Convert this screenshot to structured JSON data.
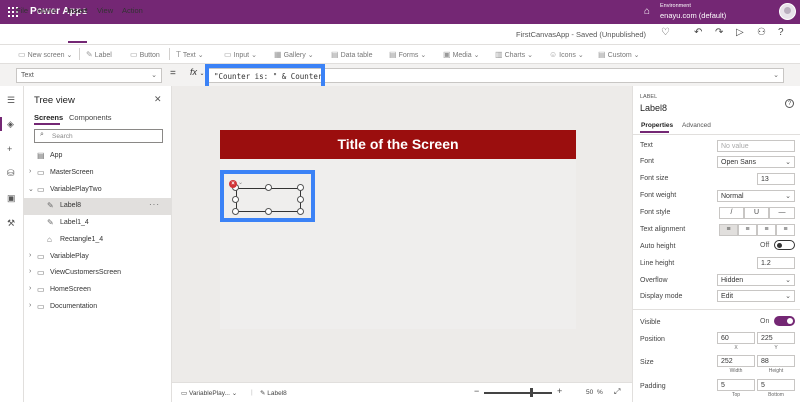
{
  "app": {
    "title": "Power Apps",
    "environment_label": "Environment",
    "environment_name": "enayu.com (default)"
  },
  "menu": {
    "items": [
      "File",
      "Home",
      "Insert",
      "View",
      "Action"
    ],
    "active": "Insert",
    "doc_status": "FirstCanvasApp - Saved (Unpublished)"
  },
  "ribbon": {
    "new_screen": "New screen",
    "label": "Label",
    "button": "Button",
    "text": "Text",
    "input": "Input",
    "gallery": "Gallery",
    "data_table": "Data table",
    "forms": "Forms",
    "media": "Media",
    "charts": "Charts",
    "icons": "Icons",
    "custom": "Custom"
  },
  "formula": {
    "property": "Text",
    "equals": "=",
    "fx": "fx",
    "expression": "\"Counter is: \" & Counter"
  },
  "tree": {
    "title": "Tree view",
    "tabs": [
      "Screens",
      "Components"
    ],
    "search_placeholder": "Search",
    "items": [
      {
        "label": "App"
      },
      {
        "label": "MasterScreen"
      },
      {
        "label": "VariablePlayTwo"
      },
      {
        "label": "Label8"
      },
      {
        "label": "Label1_4"
      },
      {
        "label": "Rectangle1_4"
      },
      {
        "label": "VariablePlay"
      },
      {
        "label": "ViewCustomersScreen"
      },
      {
        "label": "HomeScreen"
      },
      {
        "label": "Documentation"
      }
    ]
  },
  "canvas": {
    "screen_title": "Title of the Screen"
  },
  "statusbar": {
    "screen": "VariablePlay...",
    "control": "Label8",
    "zoom_minus": "−",
    "zoom_plus": "+",
    "zoom_value": "50",
    "zoom_unit": "%"
  },
  "properties": {
    "control_type": "LABEL",
    "control_name": "Label8",
    "tabs": [
      "Properties",
      "Advanced"
    ],
    "text_label": "Text",
    "text_placeholder": "No value",
    "font_label": "Font",
    "font_value": "Open Sans",
    "font_size_label": "Font size",
    "font_size_value": "13",
    "font_weight_label": "Font weight",
    "font_weight_value": "Normal",
    "font_style_label": "Font style",
    "font_style_italic": "/",
    "font_style_underline": "U",
    "font_style_strike": "—",
    "text_alignment_label": "Text alignment",
    "auto_height_label": "Auto height",
    "auto_height_value": "Off",
    "line_height_label": "Line height",
    "line_height_value": "1.2",
    "overflow_label": "Overflow",
    "overflow_value": "Hidden",
    "display_mode_label": "Display mode",
    "display_mode_value": "Edit",
    "visible_label": "Visible",
    "visible_value": "On",
    "position_label": "Position",
    "position_x": "60",
    "position_y": "225",
    "x_label": "X",
    "y_label": "Y",
    "size_label": "Size",
    "size_width": "252",
    "size_height": "88",
    "width_label": "Width",
    "height_label": "Height",
    "padding_label": "Padding",
    "padding_top": "5",
    "padding_bottom": "5",
    "top_label": "Top",
    "bottom_label": "Bottom"
  }
}
